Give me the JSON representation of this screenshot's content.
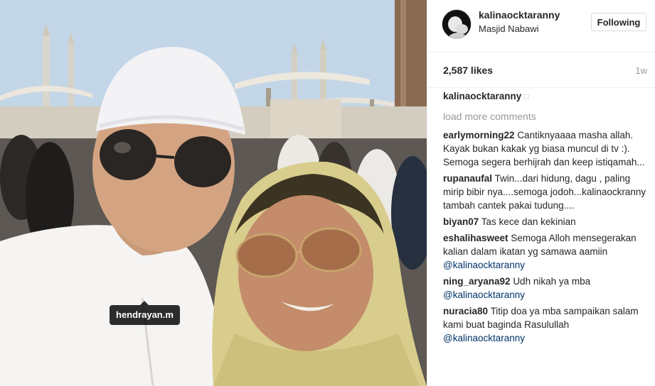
{
  "photo": {
    "tag_label": "hendrayan.m"
  },
  "post": {
    "username": "kalinaocktaranny",
    "location": "Masjid Nabawi",
    "follow_button": "Following",
    "likes": "2,587 likes",
    "time": "1w"
  },
  "caption": {
    "author": "kalinaocktaranny",
    "text": "□"
  },
  "load_more": "load more comments",
  "comments": [
    {
      "author": "earlymorning22",
      "text": "Cantiknyaaaa masha allah. Kayak bukan kakak yg biasa muncul di tv :). Semoga segera berhijrah dan keep istiqamah...",
      "mention": ""
    },
    {
      "author": "rupanaufal",
      "text": "Twin...dari hidung, dagu , paling mirip bibir nya....semoga jodoh...kalinaockranny tambah cantek pakai tudung....",
      "mention": ""
    },
    {
      "author": "biyan07",
      "text": "Tas kece dan kekinian",
      "mention": ""
    },
    {
      "author": "eshalihasweet",
      "text": "Semoga Alloh mensegerakan kalian dalam ikatan yg samawa aamiin",
      "mention": "@kalinaocktaranny"
    },
    {
      "author": "ning_aryana92",
      "text": "Udh nikah ya mba",
      "mention": "@kalinaocktaranny"
    },
    {
      "author": "nuracia80",
      "text": "Titip doa ya mba sampaikan salam kami buat baginda Rasulullah",
      "mention": "@kalinaocktaranny"
    }
  ],
  "icons": {
    "avatar": "avatar-photo",
    "person_tag": "tag-icon"
  }
}
